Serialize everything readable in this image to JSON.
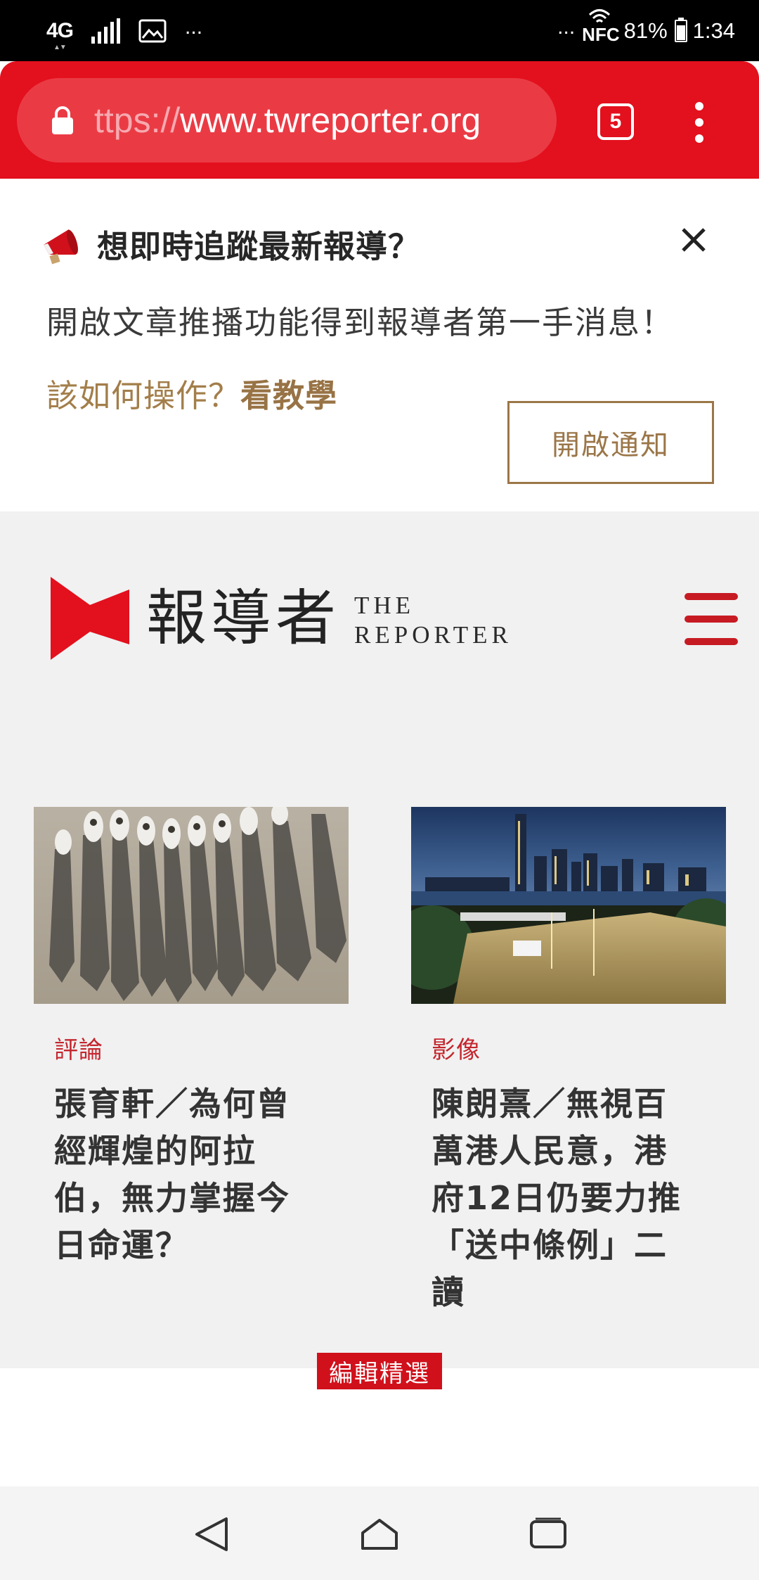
{
  "status_bar": {
    "network": "4G",
    "left_overflow": "...",
    "right_overflow": "...",
    "nfc": "NFC",
    "battery_percent": "81%",
    "battery_level": 0.81,
    "time": "1:34",
    "icons": [
      "signal-icon",
      "gallery-icon",
      "wifi-icon",
      "battery-icon"
    ]
  },
  "browser": {
    "url_faded": "ttps://",
    "url_main": "www.twreporter.org",
    "tab_count": "5",
    "toolbar_color": "#e3101e"
  },
  "notification_prompt": {
    "title": "想即時追蹤最新報導？",
    "body": "開啟文章推播功能得到報導者第一手消息！",
    "howto_text": "該如何操作？",
    "tutorial_link": "看教學",
    "enable_button": "開啟通知",
    "accent_color": "#9b7648"
  },
  "site_header": {
    "logo_cn": "報導者",
    "logo_en_line1": "THE",
    "logo_en_line2": "REPORTER",
    "brand_color": "#e3101e"
  },
  "articles": [
    {
      "category": "評論",
      "headline": "張育軒／為何曾經輝煌的阿拉伯，無力掌握今日命運？",
      "image": "aerial-crowd-shadows-photo"
    },
    {
      "category": "影像",
      "headline": "陳朗熹／無視百萬港人民意，港府12日仍要力推「送中條例」二讀",
      "image": "hong-kong-night-protest-photo"
    }
  ],
  "editor_picks": {
    "label": "編輯精選"
  },
  "nav_bar": {
    "buttons": [
      "back-icon",
      "home-icon",
      "recents-icon"
    ]
  }
}
